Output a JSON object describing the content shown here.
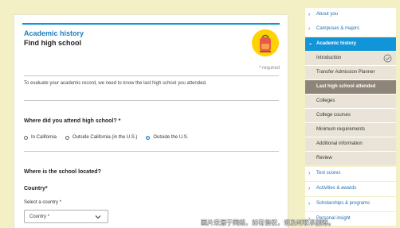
{
  "form": {
    "section_title": "Academic history",
    "page_title": "Find high school",
    "required_note": "* required",
    "intro_text": "To evaluate your academic record, we need to know the last high school you attended.",
    "question_attend": "Where did you attend high school? *",
    "radio_options": [
      "In California",
      "Outside California (in the U.S.)",
      "Outside the U.S."
    ],
    "selected_option": "Outside the U.S.",
    "question_location": "Where is the school located?",
    "country_heading": "Country*",
    "select_label": "Select a country *",
    "select_value": "Country *"
  },
  "sidebar": {
    "about_you": "About you",
    "campuses": "Campuses & majors",
    "academic_history": "Academic history",
    "introduction": "Introduction",
    "transfer_planner": "Transfer Admission Planner",
    "last_high_school": "Last high school attended",
    "colleges": "Colleges",
    "college_courses": "College courses",
    "minimum_requirements": "Minimum requirements",
    "additional_information": "Additional information",
    "review": "Review",
    "test_scores": "Test scores",
    "activities_awards": "Activities & awards",
    "scholarships_programs": "Scholarships & programs",
    "personal_insight": "Personal insight"
  },
  "watermark": "图片来源于网络，如有侵权，请及时联系删除。",
  "colors": {
    "accent": "#1295d8",
    "current_item": "#8e8477",
    "background": "#f3f0c6"
  },
  "icons": [
    "backpack-icon",
    "chevron-right-icon",
    "chevron-down-icon",
    "check-circle-icon"
  ]
}
